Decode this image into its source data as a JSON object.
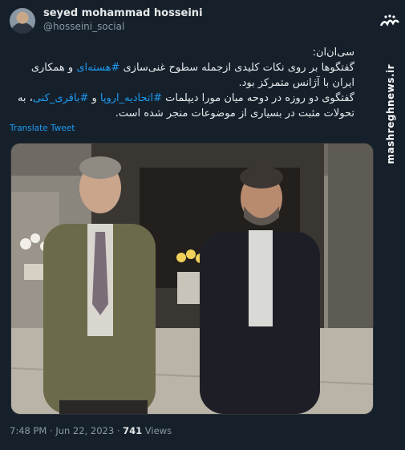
{
  "tweet": {
    "display_name": "seyed mohammad hosseini",
    "handle": "@hosseini_social",
    "lines": {
      "l1": "سی‌ان‌ان:",
      "l2_pre": "گفتگوها بر روی نکات کلیدی ازجمله سطوح غنی‌سازی ",
      "l2_tag": "#هسته‌ای",
      "l2_post": " و همکاری",
      "l3": "ایران با آژانس متمرکز بود.",
      "l4_pre": "گفتگوی دو روزه در دوحه میان مورا دیپلمات ",
      "l4_tag1": "#اتحادیه_اروپا",
      "l4_mid": " و ",
      "l4_tag2": "#باقری_کنی",
      "l4_post": "، به",
      "l5": "تحولات مثبت در بسیاری از موضوعات منجر شده است."
    },
    "translate_label": "Translate Tweet",
    "time": "7:48 PM",
    "separator": "·",
    "date": "Jun 22, 2023",
    "views_count": "741",
    "views_label": "Views"
  },
  "watermark": {
    "logo_text": "مشرق",
    "site": "mashreghnews.ir"
  },
  "colors": {
    "background": "#15202b",
    "link": "#1d9bf0",
    "muted": "#8b98a5"
  }
}
